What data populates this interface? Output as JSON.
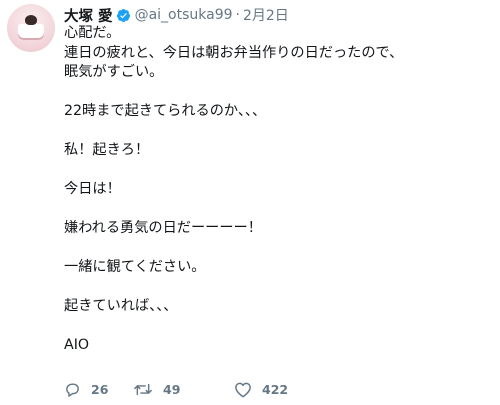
{
  "tweet": {
    "display_name": "大塚 愛",
    "handle": "@ai_otsuka99",
    "separator": "·",
    "date": "2月2日",
    "lines": [
      "心配だ。",
      "連日の疲れと、今日は朝お弁当作りの日だったので、",
      "眠気がすごい。",
      "",
      "22時まで起きてられるのか、、、",
      "",
      "私！起きろ！",
      "",
      "今日は！",
      "",
      "嫌われる勇気の日だーーーー！",
      "",
      "一緒に観てください。",
      "",
      "起きていれば、、、",
      "",
      "AIO"
    ],
    "actions": {
      "reply_count": "26",
      "retweet_count": "49",
      "like_count": "422"
    },
    "icons": {
      "verified": "verified-badge-icon",
      "reply": "reply-icon",
      "retweet": "retweet-icon",
      "like": "heart-icon"
    },
    "colors": {
      "verified_blue": "#1da1f2",
      "secondary_text": "#657786",
      "primary_text": "#14171a"
    }
  }
}
